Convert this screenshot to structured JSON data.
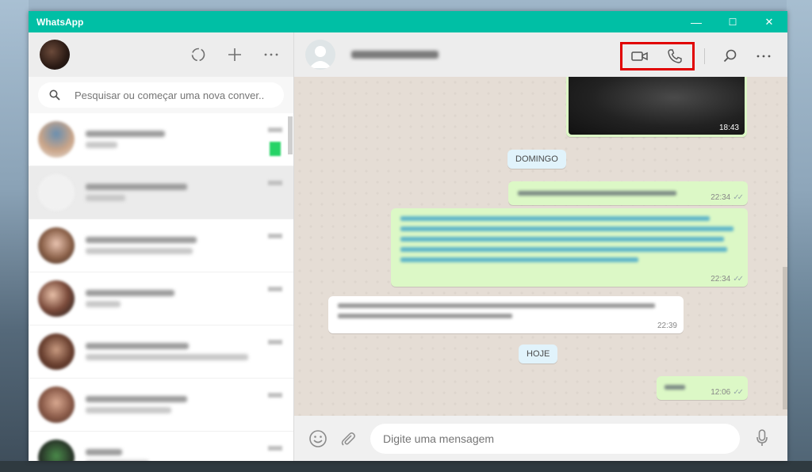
{
  "window": {
    "title": "WhatsApp",
    "controls": {
      "minimize": "—",
      "maximize": "☐",
      "close": "✕"
    }
  },
  "sidebar": {
    "icons": [
      "status-icon",
      "new-chat-icon",
      "menu-icon"
    ],
    "search": {
      "placeholder": "Pesquisar ou começar uma nova conver..."
    },
    "chats_count": 7
  },
  "chat": {
    "header_icons": [
      "video-call-icon",
      "voice-call-icon",
      "search-icon",
      "menu-icon"
    ],
    "highlight_color": "#e10000",
    "messages": [
      {
        "type": "image",
        "direction": "out",
        "time": "18:43"
      },
      {
        "type": "date",
        "label": "DOMINGO"
      },
      {
        "type": "text",
        "direction": "out",
        "time": "22:34"
      },
      {
        "type": "text",
        "direction": "out",
        "time": "22:34"
      },
      {
        "type": "text",
        "direction": "in",
        "time": "22:39"
      },
      {
        "type": "date",
        "label": "HOJE"
      },
      {
        "type": "text",
        "direction": "out",
        "time": "12:06"
      }
    ],
    "composer": {
      "placeholder": "Digite uma mensagem"
    }
  },
  "colors": {
    "accent": "#00bfa5",
    "outgoing_bubble": "#dcf8c6",
    "incoming_bubble": "#ffffff",
    "date_chip": "#e1f3fb"
  }
}
